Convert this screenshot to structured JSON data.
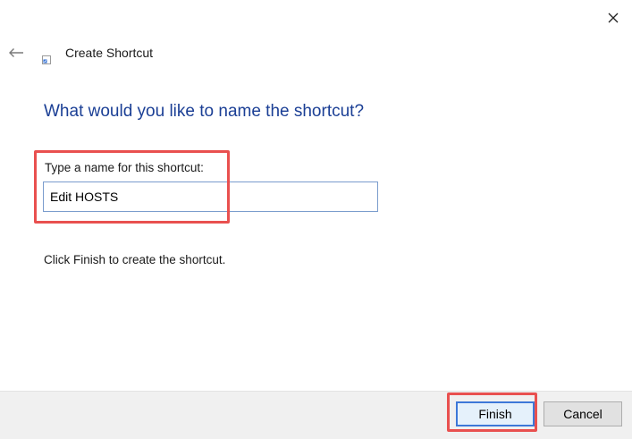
{
  "window": {
    "close_icon": "close-icon",
    "back_icon": "back-arrow-icon"
  },
  "wizard": {
    "title": "Create Shortcut",
    "icon": "shortcut-icon"
  },
  "main": {
    "heading": "What would you like to name the shortcut?",
    "field_label": "Type a name for this shortcut:",
    "name_value": "Edit HOSTS",
    "finish_note": "Click Finish to create the shortcut."
  },
  "footer": {
    "finish_label": "Finish",
    "cancel_label": "Cancel"
  },
  "colors": {
    "heading": "#1b3f95",
    "highlight": "#e9504f",
    "input_border": "#7a9ccd",
    "default_button_border": "#3d78d8",
    "footer_bg": "#f0f0f0"
  }
}
